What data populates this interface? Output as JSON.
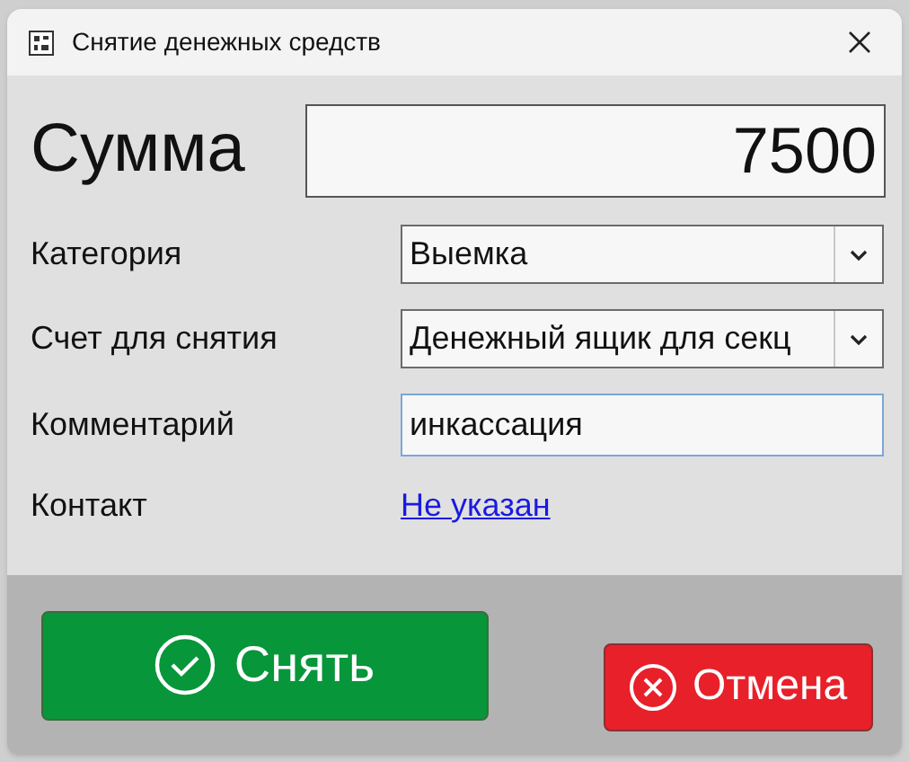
{
  "window": {
    "title": "Снятие денежных средств"
  },
  "amount": {
    "label": "Сумма",
    "value": "7500"
  },
  "fields": [
    {
      "kind": "combo",
      "label": "Категория",
      "value": "Выемка"
    },
    {
      "kind": "combo",
      "label": "Счет для снятия",
      "value": "Денежный ящик для секц"
    },
    {
      "kind": "text",
      "label": "Комментарий",
      "value": "инкассация",
      "focused": true
    },
    {
      "kind": "link",
      "label": "Контакт",
      "value": "Не указан"
    }
  ],
  "buttons": [
    {
      "kind": "confirm",
      "label": "Снять"
    },
    {
      "kind": "cancel",
      "label": "Отмена"
    }
  ]
}
